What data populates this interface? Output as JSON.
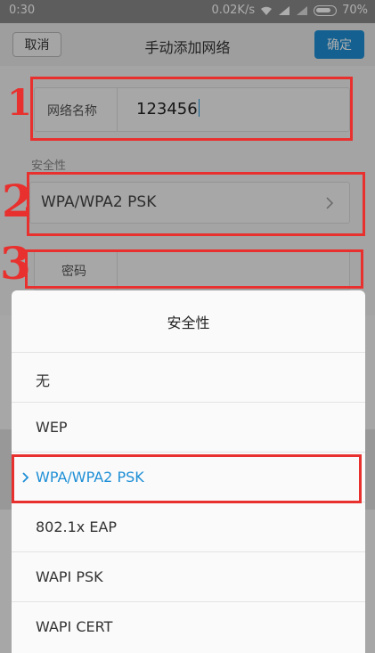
{
  "status_bar": {
    "time": "0:30",
    "net_speed": "0.02K/s",
    "battery": "70%"
  },
  "header": {
    "cancel_label": "取消",
    "title": "手动添加网络",
    "confirm_label": "确定"
  },
  "form": {
    "network_name_label": "网络名称",
    "network_name_value": "123456",
    "security_section_label": "安全性",
    "security_value": "WPA/WPA2 PSK",
    "password_label": "密码"
  },
  "dialog": {
    "title": "安全性",
    "options": [
      {
        "label": "无",
        "selected": false
      },
      {
        "label": "WEP",
        "selected": false
      },
      {
        "label": "WPA/WPA2 PSK",
        "selected": true
      },
      {
        "label": "802.1x EAP",
        "selected": false
      },
      {
        "label": "WAPI PSK",
        "selected": false
      },
      {
        "label": "WAPI CERT",
        "selected": false
      }
    ]
  },
  "annotations": {
    "step1": "1",
    "step2": "2",
    "step3": "3"
  },
  "colors": {
    "accent": "#1e8fd6",
    "annotation_red": "#e8312e"
  }
}
